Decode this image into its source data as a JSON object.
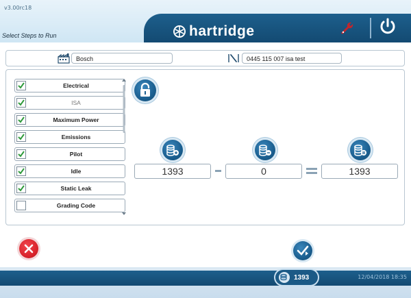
{
  "header": {
    "version": "v3.00rc18",
    "title": "Select Steps to Run",
    "logo_text": "hartridge"
  },
  "info": {
    "manufacturer": "Bosch",
    "part": "0445 115 007 isa test"
  },
  "steps": [
    {
      "label": "Electrical",
      "checked": true
    },
    {
      "label": "ISA",
      "checked": true
    },
    {
      "label": "Maximum Power",
      "checked": true
    },
    {
      "label": "Emissions",
      "checked": true
    },
    {
      "label": "Pilot",
      "checked": true
    },
    {
      "label": "Idle",
      "checked": true
    },
    {
      "label": "Static Leak",
      "checked": true
    },
    {
      "label": "Grading Code",
      "checked": false
    }
  ],
  "calculation": {
    "value_a": "1393",
    "operator_minus": "-",
    "value_b": "0",
    "operator_equals": "=",
    "result": "1393"
  },
  "footer": {
    "count": "1393",
    "datetime": "12/04/2018 18:35"
  },
  "colors": {
    "brand_blue": "#1b5f90",
    "cancel_red": "#d8222a",
    "check_green": "#2f9a3b"
  }
}
